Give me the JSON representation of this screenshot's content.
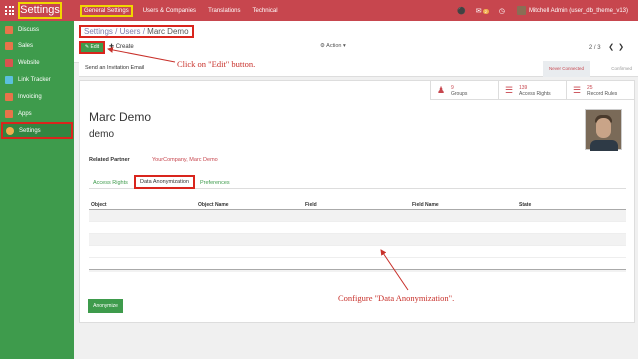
{
  "topbar": {
    "brand": "Settings",
    "menu": [
      "General Settings",
      "Users & Companies",
      "Translations",
      "Technical"
    ],
    "badge_count": "2",
    "user": "Mitchell Admin (user_db_theme_v13)"
  },
  "sidebar": {
    "items": [
      {
        "label": "Discuss",
        "color": "#e8734a"
      },
      {
        "label": "Sales",
        "color": "#e8734a"
      },
      {
        "label": "Website",
        "color": "#d9534f"
      },
      {
        "label": "Link Tracker",
        "color": "#5bc0de"
      },
      {
        "label": "Invoicing",
        "color": "#e8734a"
      },
      {
        "label": "Apps",
        "color": "#e8734a"
      },
      {
        "label": "Settings",
        "color": "#f0ad4e"
      }
    ]
  },
  "control": {
    "breadcrumb": [
      "Settings",
      "Users",
      "Marc Demo"
    ],
    "edit_label": "Edit",
    "create_label": "Create",
    "action_label": "Action",
    "pager": "2 / 3"
  },
  "statusbar": {
    "invite_label": "Send an Invitation Email",
    "status_never": "Never Connected",
    "status_confirmed": "Confirmed"
  },
  "stat_buttons": [
    {
      "num": "9",
      "label": "Groups"
    },
    {
      "num": "139",
      "label": "Access Rights"
    },
    {
      "num": "25",
      "label": "Record Rules"
    }
  ],
  "form": {
    "name": "Marc Demo",
    "login": "demo",
    "related_partner_label": "Related Partner",
    "related_partner_value": "YourCompany, Marc Demo",
    "tabs": [
      "Access Rights",
      "Data Anonymization",
      "Preferences"
    ],
    "columns": [
      "Object",
      "Object Name",
      "Field",
      "Field Name",
      "State"
    ],
    "anonymize_label": "Anonymize"
  },
  "annotations": {
    "edit_note": "Click on \"Edit\" button.",
    "tab_note": "Configure \"Data Anonymization\"."
  },
  "colors": {
    "topbar": "#c7464e",
    "sidebar": "#3e9b4c",
    "highlight_red": "#d9251d",
    "highlight_yellow": "#f1d600"
  }
}
